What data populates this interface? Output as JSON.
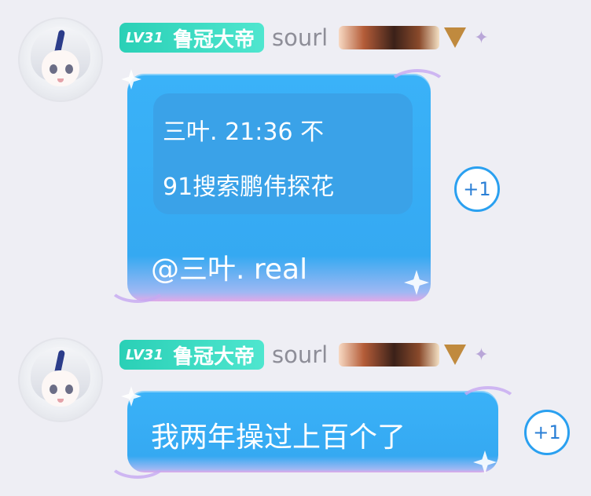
{
  "messages": [
    {
      "user": {
        "level": "LV31",
        "title": "鲁冠大帝",
        "name": "sourl",
        "badge_icon": "dragon-badge-icon"
      },
      "quote": {
        "line1": "三叶. 21:36       不",
        "line2": "91搜索鹏伟探花"
      },
      "text": "@三叶. real",
      "reaction": "+1"
    },
    {
      "user": {
        "level": "LV31",
        "title": "鲁冠大帝",
        "name": "sourl",
        "badge_icon": "dragon-badge-icon"
      },
      "text": "我两年操过上百个了",
      "reaction": "+1"
    }
  ],
  "colors": {
    "background": "#eeeef4",
    "bubble": "#3ab2f8",
    "level_badge": "#2ad0b6",
    "reaction_border": "#2aa0f0"
  }
}
